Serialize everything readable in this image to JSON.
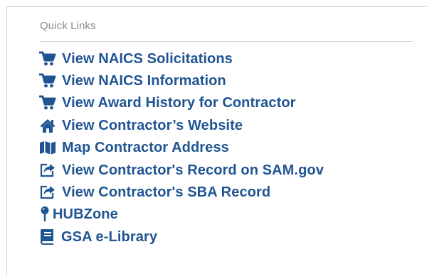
{
  "quick_links": {
    "title": "Quick Links",
    "items": [
      {
        "label": "View NAICS Solicitations",
        "icon": "shopping-cart-icon"
      },
      {
        "label": "View NAICS Information",
        "icon": "shopping-cart-icon"
      },
      {
        "label": "View Award History for Contractor",
        "icon": "shopping-cart-icon"
      },
      {
        "label": "View Contractor’s Website",
        "icon": "home-icon"
      },
      {
        "label": "Map Contractor Address",
        "icon": "map-icon"
      },
      {
        "label": "View Contractor's Record on SAM.gov",
        "icon": "share-icon"
      },
      {
        "label": "View Contractor's SBA Record",
        "icon": "share-icon"
      },
      {
        "label": "HUBZone",
        "icon": "map-pin-icon"
      },
      {
        "label": "GSA e-Library",
        "icon": "book-icon"
      }
    ]
  },
  "colors": {
    "link": "#205493",
    "title": "#8a8a8a",
    "border": "#cfcfcf"
  }
}
